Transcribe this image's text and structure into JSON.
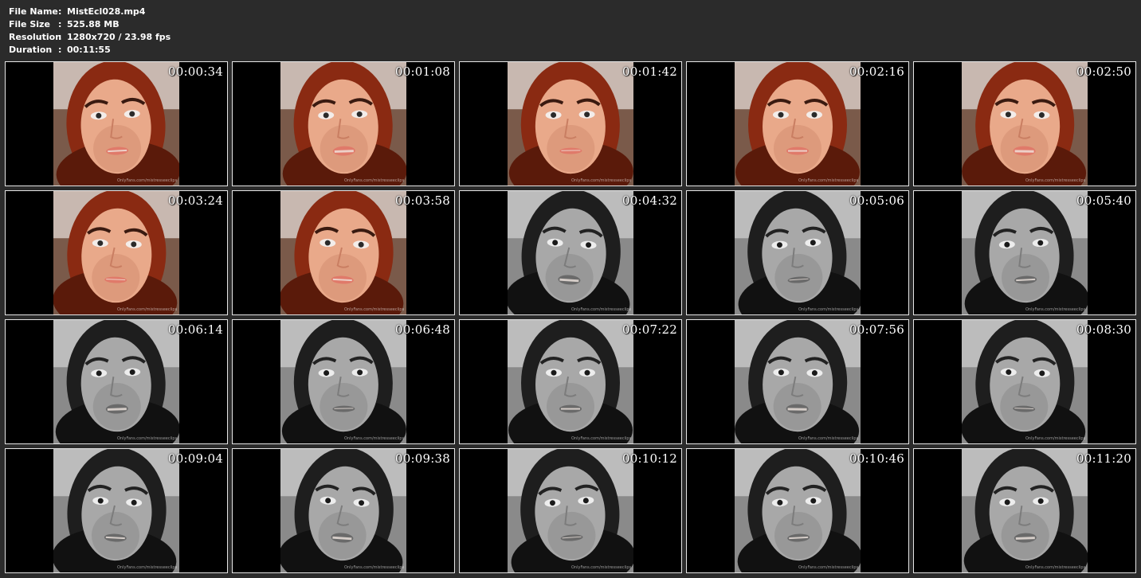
{
  "file_info": [
    {
      "label": "File Name",
      "value": "MistEcl028.mp4"
    },
    {
      "label": "File Size",
      "value": "525.88 MB"
    },
    {
      "label": "Resolution",
      "value": "1280x720 / 23.98 fps"
    },
    {
      "label": "Duration",
      "value": "00:11:55"
    }
  ],
  "separator": ":",
  "watermark": "OnlyFans.com/mistresseeclips",
  "colors": {
    "background": "#2b2b2b",
    "thumb_border": "#e6e6e6",
    "text": "#ffffff"
  },
  "thumbnails": [
    {
      "timestamp": "00:00:34",
      "tone": "color"
    },
    {
      "timestamp": "00:01:08",
      "tone": "color"
    },
    {
      "timestamp": "00:01:42",
      "tone": "color"
    },
    {
      "timestamp": "00:02:16",
      "tone": "color"
    },
    {
      "timestamp": "00:02:50",
      "tone": "color"
    },
    {
      "timestamp": "00:03:24",
      "tone": "color"
    },
    {
      "timestamp": "00:03:58",
      "tone": "color"
    },
    {
      "timestamp": "00:04:32",
      "tone": "gray"
    },
    {
      "timestamp": "00:05:06",
      "tone": "gray"
    },
    {
      "timestamp": "00:05:40",
      "tone": "gray"
    },
    {
      "timestamp": "00:06:14",
      "tone": "gray"
    },
    {
      "timestamp": "00:06:48",
      "tone": "gray"
    },
    {
      "timestamp": "00:07:22",
      "tone": "gray"
    },
    {
      "timestamp": "00:07:56",
      "tone": "gray"
    },
    {
      "timestamp": "00:08:30",
      "tone": "gray"
    },
    {
      "timestamp": "00:09:04",
      "tone": "gray"
    },
    {
      "timestamp": "00:09:38",
      "tone": "gray"
    },
    {
      "timestamp": "00:10:12",
      "tone": "gray"
    },
    {
      "timestamp": "00:10:46",
      "tone": "gray"
    },
    {
      "timestamp": "00:11:20",
      "tone": "gray"
    }
  ]
}
